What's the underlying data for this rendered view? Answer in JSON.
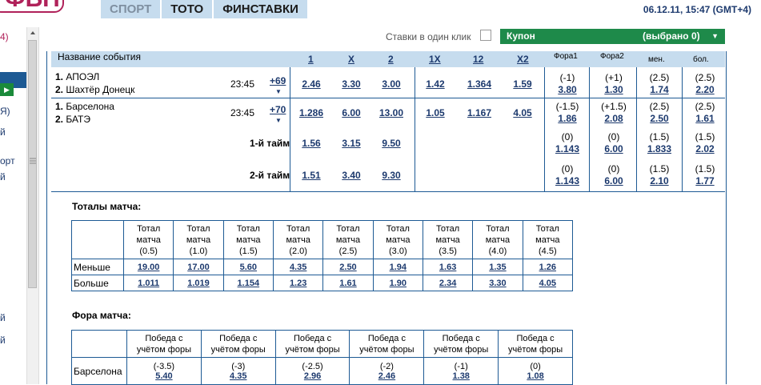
{
  "header": {
    "logo_text": "ФБН",
    "nav": [
      "СПОРТ",
      "ТОТО",
      "ФИНСТАВКИ"
    ],
    "datetime": "06.12.11, 15:47 (GMT+4)"
  },
  "sidebar": {
    "fragments": [
      "4)",
      "Я)",
      "й",
      "орт",
      "й",
      "й",
      "й"
    ]
  },
  "controls": {
    "oneclick_label": "Ставки в один клик",
    "coupon_label": "Купон",
    "coupon_selected": "(выбрано 0)"
  },
  "table_header": {
    "event_name": "Название события",
    "cols": [
      "1",
      "X",
      "2",
      "1X",
      "12",
      "X2"
    ],
    "fora1": "Фора1",
    "fora2": "Фора2",
    "less": "мен.",
    "more": "бол."
  },
  "events": [
    {
      "team1": "АПОЭЛ",
      "team2": "Шахтёр Донецк",
      "time": "23:45",
      "plus": "+69",
      "odds": [
        "2.46",
        "3.30",
        "3.00",
        "1.42",
        "1.364",
        "1.59"
      ],
      "fora1": [
        "(-1)",
        "3.80"
      ],
      "fora2": [
        "(+1)",
        "1.30"
      ],
      "less": [
        "(2.5)",
        "1.74"
      ],
      "more": [
        "(2.5)",
        "2.20"
      ]
    },
    {
      "team1": "Барселона",
      "team2": "БАТЭ",
      "time": "23:45",
      "plus": "+70",
      "odds": [
        "1.286",
        "6.00",
        "13.00",
        "1.05",
        "1.167",
        "4.05"
      ],
      "fora1": [
        "(-1.5)",
        "1.86"
      ],
      "fora2": [
        "(+1.5)",
        "2.08"
      ],
      "less": [
        "(2.5)",
        "2.50"
      ],
      "more": [
        "(2.5)",
        "1.61"
      ]
    }
  ],
  "halves": [
    {
      "label": "1-й тайм",
      "odds": [
        "1.56",
        "3.15",
        "9.50"
      ],
      "fora1": [
        "(0)",
        "1.143"
      ],
      "fora2": [
        "(0)",
        "6.00"
      ],
      "less": [
        "(1.5)",
        "1.833"
      ],
      "more": [
        "(1.5)",
        "2.02"
      ]
    },
    {
      "label": "2-й тайм",
      "odds": [
        "1.51",
        "3.40",
        "9.30"
      ],
      "fora1": [
        "(0)",
        "1.143"
      ],
      "fora2": [
        "(0)",
        "6.00"
      ],
      "less": [
        "(1.5)",
        "2.10"
      ],
      "more": [
        "(1.5)",
        "1.77"
      ]
    }
  ],
  "totals": {
    "title": "Тоталы матча:",
    "headers": [
      "Тотал\nматча\n(0.5)",
      "Тотал\nматча\n(1.0)",
      "Тотал\nматча\n(1.5)",
      "Тотал\nматча\n(2.0)",
      "Тотал\nматча\n(2.5)",
      "Тотал\nматча\n(3.0)",
      "Тотал\nматча\n(3.5)",
      "Тотал\nматча\n(4.0)",
      "Тотал\nматча\n(4.5)"
    ],
    "rows": [
      {
        "label": "Меньше",
        "values": [
          "19.00",
          "17.00",
          "5.60",
          "4.35",
          "2.50",
          "1.94",
          "1.63",
          "1.35",
          "1.26"
        ]
      },
      {
        "label": "Больше",
        "values": [
          "1.011",
          "1.019",
          "1.154",
          "1.23",
          "1.61",
          "1.90",
          "2.34",
          "3.30",
          "4.05"
        ]
      }
    ]
  },
  "fora": {
    "title": "Фора матча:",
    "headers": [
      "Победа с\nучётом форы",
      "Победа с\nучётом форы",
      "Победа с\nучётом форы",
      "Победа с\nучётом форы",
      "Победа с\nучётом форы",
      "Победа с\nучётом форы"
    ],
    "rows": [
      {
        "label": "Барселона",
        "values": [
          [
            "(-3.5)",
            "5.40"
          ],
          [
            "(-3)",
            "4.35"
          ],
          [
            "(-2.5)",
            "2.96"
          ],
          [
            "(-2)",
            "2.46"
          ],
          [
            "(-1)",
            "1.38"
          ],
          [
            "(0)",
            "1.08"
          ]
        ]
      }
    ]
  }
}
